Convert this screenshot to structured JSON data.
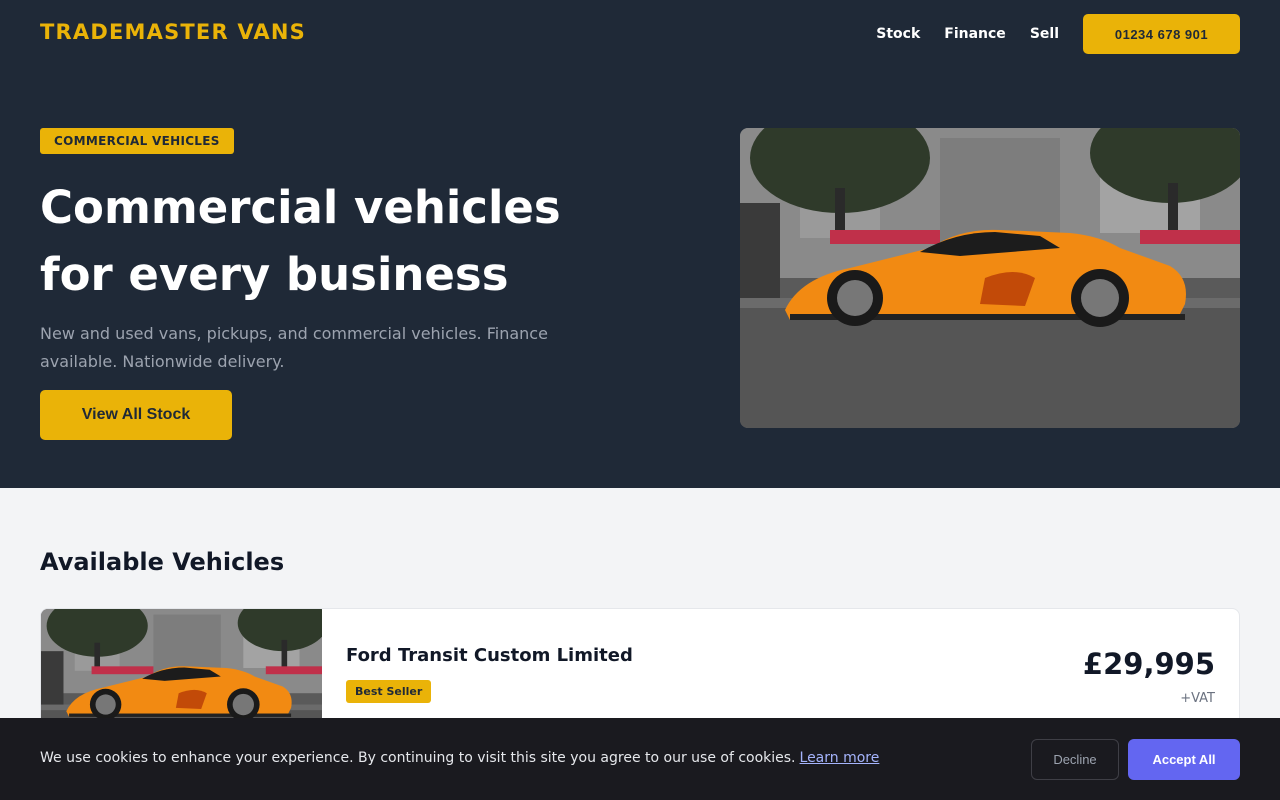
{
  "header": {
    "logo": "TRADEMASTER VANS",
    "nav": [
      "Stock",
      "Finance",
      "Sell"
    ],
    "phone": "01234 678 901"
  },
  "hero": {
    "badge": "COMMERCIAL VEHICLES",
    "title_line1": "Commercial vehicles",
    "title_line2": "for every business",
    "subtitle": "New and used vans, pickups, and commercial vehicles. Finance available. Nationwide delivery.",
    "cta": "View All Stock"
  },
  "vehicles": {
    "section_title": "Available Vehicles",
    "items": [
      {
        "title": "Ford Transit Custom Limited",
        "badge": "Best Seller",
        "price": "£29,995",
        "price_note": "+VAT"
      }
    ]
  },
  "cookie": {
    "text": "We use cookies to enhance your experience. By continuing to visit this site you agree to our use of cookies.",
    "link": "Learn more",
    "decline": "Decline",
    "accept": "Accept All"
  },
  "colors": {
    "dark_bg": "#1f2937",
    "accent": "#eab308",
    "accept": "#6366f1"
  }
}
